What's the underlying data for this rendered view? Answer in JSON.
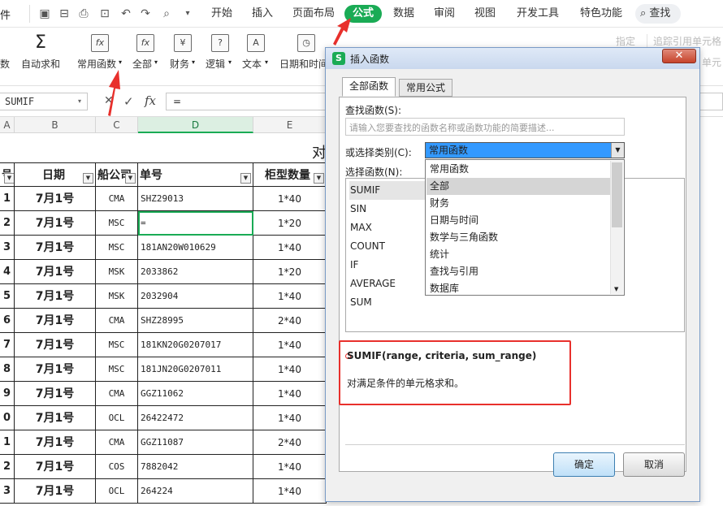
{
  "ribbon": {
    "left_cut": "件",
    "tabs": [
      "开始",
      "插入",
      "页面布局",
      "公式",
      "数据",
      "审阅",
      "视图",
      "开发工具",
      "特色功能"
    ],
    "active_tab": "公式",
    "search": "查找",
    "left_edge": "数",
    "groups": [
      {
        "icon": "Σ",
        "label": "自动求和"
      },
      {
        "icon": "fx",
        "label": "常用函数"
      },
      {
        "icon": "fx",
        "label": "全部"
      },
      {
        "icon": "¥",
        "label": "财务"
      },
      {
        "icon": "?",
        "label": "逻辑"
      },
      {
        "icon": "A",
        "label": "文本"
      },
      {
        "icon": "◷",
        "label": "日期和时间"
      }
    ],
    "right_labels": [
      "指定",
      "追踪引用单元格",
      "单元"
    ]
  },
  "formula_bar": {
    "name_box": "SUMIF",
    "cancel": "✕",
    "accept": "✓",
    "fx": "fx",
    "value": "="
  },
  "columns": [
    "A",
    "B",
    "C",
    "D",
    "E"
  ],
  "sheet": {
    "title_cut": "对",
    "headers": {
      "date": "日期",
      "ship": "船公司",
      "no": "单号",
      "ct": "柜型数量"
    },
    "rows": [
      {
        "n": "1",
        "date": "7月1号",
        "ship": "CMA",
        "no": "SHZ29013",
        "ct": "1*40"
      },
      {
        "n": "2",
        "date": "7月1号",
        "ship": "MSC",
        "no": "=",
        "ct": "1*20"
      },
      {
        "n": "3",
        "date": "7月1号",
        "ship": "MSC",
        "no": "181AN20W010629",
        "ct": "1*40"
      },
      {
        "n": "4",
        "date": "7月1号",
        "ship": "MSK",
        "no": "2033862",
        "ct": "1*20"
      },
      {
        "n": "5",
        "date": "7月1号",
        "ship": "MSK",
        "no": "2032904",
        "ct": "1*40"
      },
      {
        "n": "6",
        "date": "7月1号",
        "ship": "CMA",
        "no": "SHZ28995",
        "ct": "2*40"
      },
      {
        "n": "7",
        "date": "7月1号",
        "ship": "MSC",
        "no": "181KN20G0207017",
        "ct": "1*40"
      },
      {
        "n": "8",
        "date": "7月1号",
        "ship": "MSC",
        "no": "181JN20G0207011",
        "ct": "1*40"
      },
      {
        "n": "9",
        "date": "7月1号",
        "ship": "CMA",
        "no": "GGZ11062",
        "ct": "1*40"
      },
      {
        "n": "0",
        "date": "7月1号",
        "ship": "OCL",
        "no": "26422472",
        "ct": "1*40"
      },
      {
        "n": "1",
        "date": "7月1号",
        "ship": "CMA",
        "no": "GGZ11087",
        "ct": "2*40"
      },
      {
        "n": "2",
        "date": "7月1号",
        "ship": "COS",
        "no": "7882042",
        "ct": "1*40"
      },
      {
        "n": "3",
        "date": "7月1号",
        "ship": "OCL",
        "no": "264224",
        "ct": "1*40"
      }
    ]
  },
  "dialog": {
    "title": "插入函数",
    "close": "✕",
    "tabs": [
      "全部函数",
      "常用公式"
    ],
    "search_label": "查找函数(S):",
    "search_placeholder": "请输入您要查找的函数名称或函数功能的简要描述...",
    "category_label": "或选择类别(C):",
    "category_value": "常用函数",
    "categories": [
      "常用函数",
      "全部",
      "财务",
      "日期与时间",
      "数学与三角函数",
      "统计",
      "查找与引用",
      "数据库"
    ],
    "highlighted_category": "全部",
    "select_label": "选择函数(N):",
    "functions": [
      "SUMIF",
      "SIN",
      "MAX",
      "COUNT",
      "IF",
      "AVERAGE",
      "SUM"
    ],
    "selected_function": "SUMIF",
    "signature": "SUMIF(range, criteria, sum_range)",
    "description": "对满足条件的单元格求和。",
    "ok": "确定",
    "cancel": "取消"
  },
  "colors": {
    "accent": "#1aab55",
    "annotation": "#e8302c",
    "selection": "#3399ff"
  }
}
